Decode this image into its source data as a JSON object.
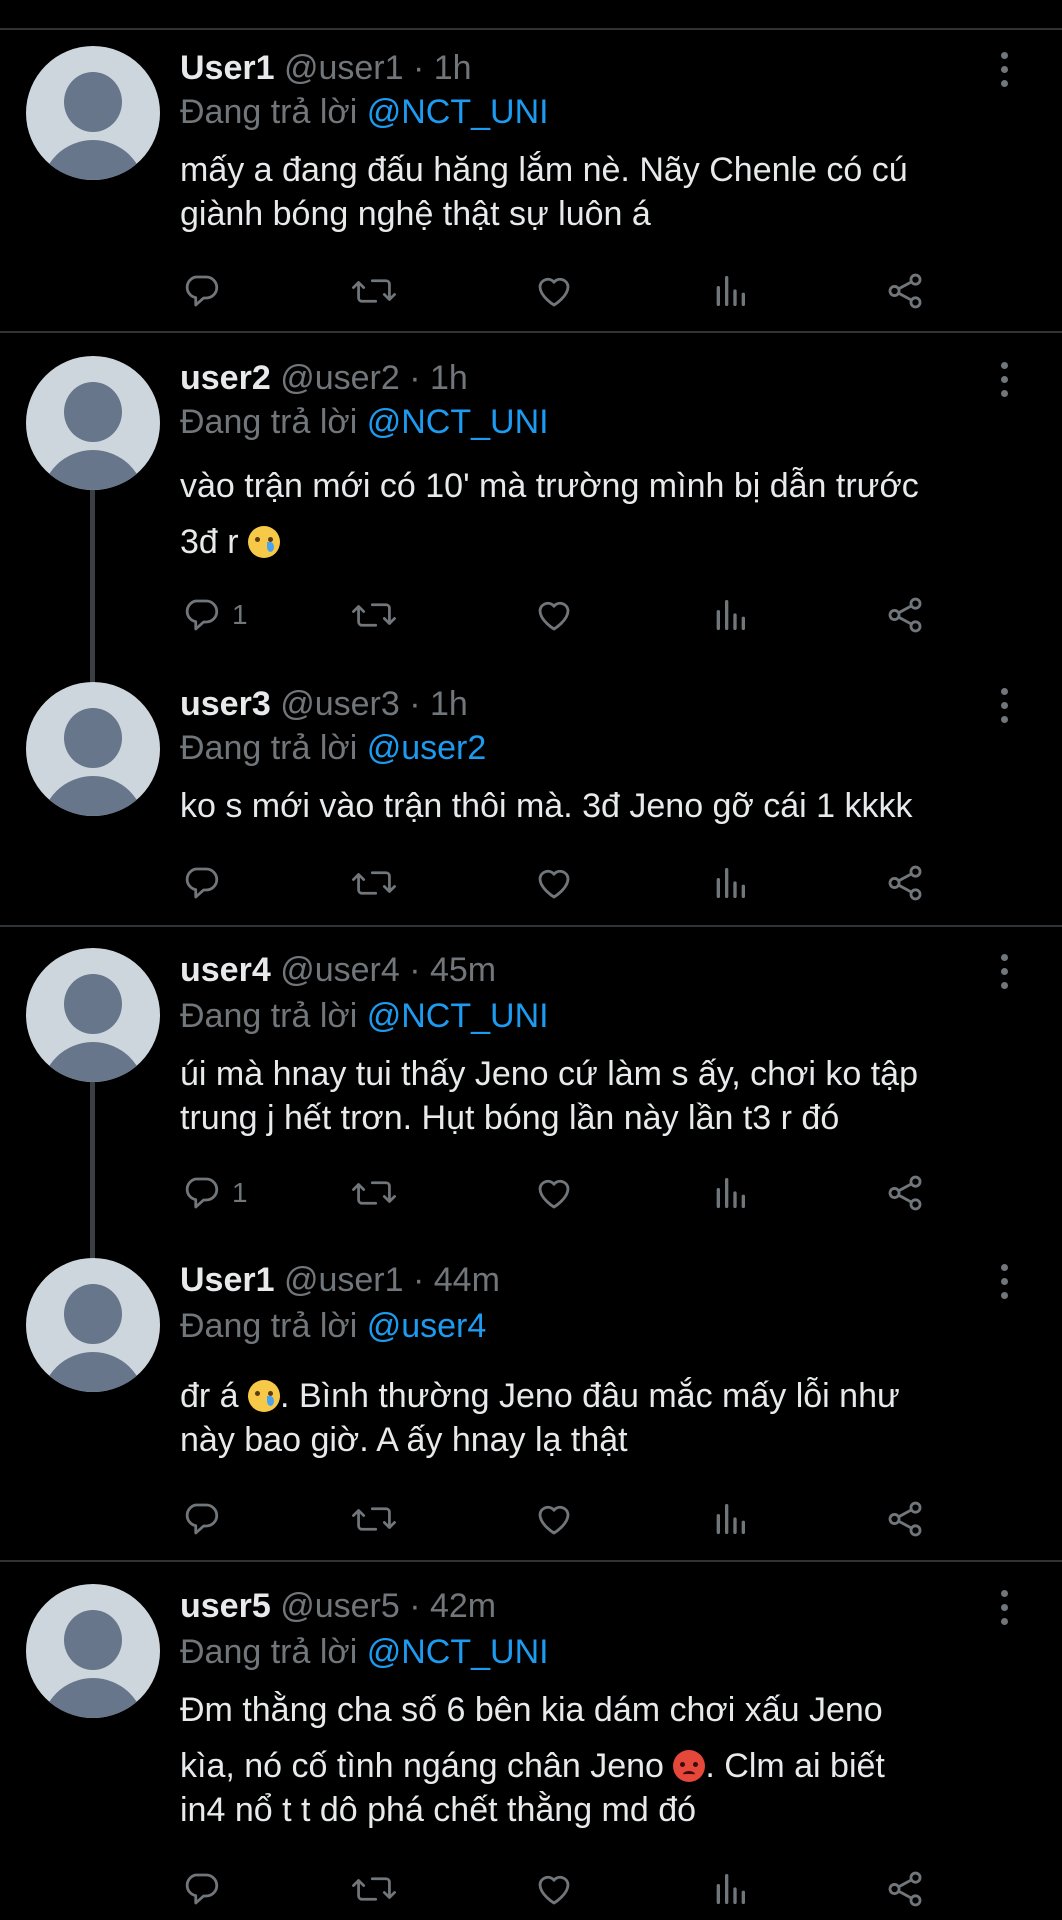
{
  "reply_prefix": "Đang trả lời",
  "tweets": [
    {
      "name": "User1",
      "handle": "@user1",
      "sep": " · ",
      "time": "1h",
      "reply_to": "@NCT_UNI",
      "text_lines": [
        "mấy a đang đấu hăng lắm nè. Nãy Chenle có cú",
        "giành bóng nghệ thật sự luôn á"
      ],
      "reply_count": ""
    },
    {
      "name": "user2",
      "handle": "@user2",
      "sep": " · ",
      "time": "1h",
      "reply_to": "@NCT_UNI",
      "text_lines": [
        "vào trận mới có 10' mà trường mình bị dẫn trước",
        "3đ r"
      ],
      "reply_count": "1"
    },
    {
      "name": "user3",
      "handle": "@user3",
      "sep": " · ",
      "time": "1h",
      "reply_to": "@user2",
      "text_lines": [
        "ko s mới vào trận thôi mà. 3đ Jeno gỡ cái 1 kkkk"
      ],
      "reply_count": ""
    },
    {
      "name": "user4",
      "handle": "@user4",
      "sep": " · ",
      "time": "45m",
      "reply_to": "@NCT_UNI",
      "text_lines": [
        "úi mà hnay tui thấy Jeno cứ làm s ấy, chơi ko tập",
        "trung j hết trơn. Hụt bóng lần này lần t3 r đó"
      ],
      "reply_count": "1"
    },
    {
      "name": "User1",
      "handle": "@user1",
      "sep": " · ",
      "time": "44m",
      "reply_to": "@user4",
      "text_lines": [
        "đr á",
        ". Bình thường Jeno đâu mắc mấy lỗi như",
        "này bao giờ. A ấy hnay lạ thật"
      ],
      "reply_count": ""
    },
    {
      "name": "user5",
      "handle": "@user5",
      "sep": " · ",
      "time": "42m",
      "reply_to": "@NCT_UNI",
      "text_lines": [
        "Đm thằng cha số 6 bên kia dám chơi xấu Jeno",
        "kìa, nó cố tình ngáng chân Jeno",
        ". Clm ai biết",
        "in4 nổ t t dô phá chết thằng md đó"
      ],
      "reply_count": ""
    }
  ],
  "icons": {
    "reply": "reply-icon",
    "retweet": "retweet-icon",
    "like": "heart-icon",
    "views": "views-icon",
    "share": "share-icon",
    "more": "more-options-icon"
  },
  "colors": {
    "background": "#000000",
    "text": "#e7e9ea",
    "muted": "#71767b",
    "mention": "#1d9bf0",
    "separator": "#2f3336"
  }
}
